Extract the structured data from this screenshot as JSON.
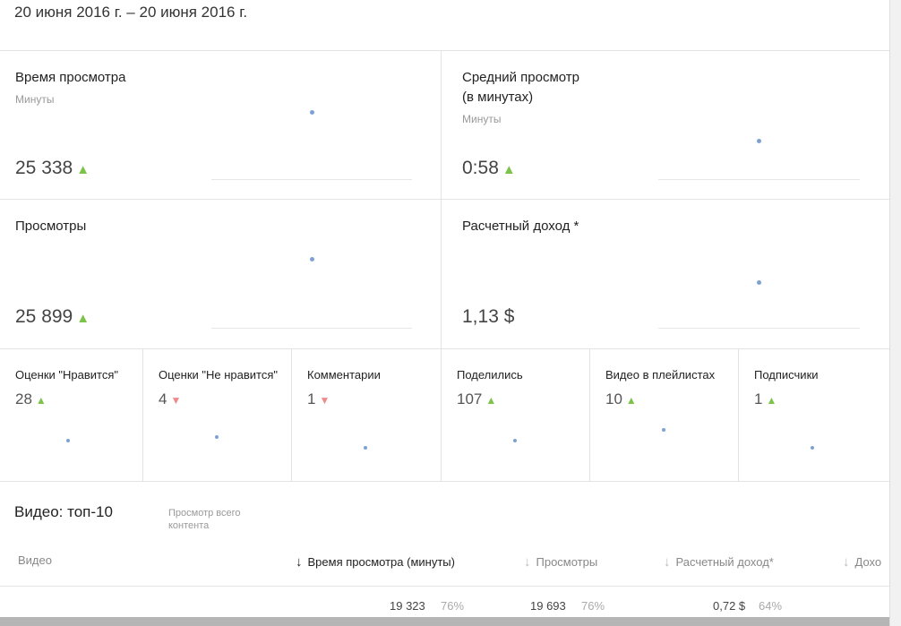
{
  "date_range": "20 июня 2016 г. – 20 июня 2016 г.",
  "big_cards": [
    {
      "title": "Время просмотра",
      "subtitle": "Минуты",
      "value": "25 338",
      "trend": "up"
    },
    {
      "title": "Средний просмотр",
      "title2": "(в минутах)",
      "subtitle": "Минуты",
      "value": "0:58",
      "trend": "up"
    },
    {
      "title": "Просмотры",
      "value": "25 899",
      "trend": "up"
    },
    {
      "title": "Расчетный доход *",
      "value": "1,13 $"
    }
  ],
  "small_cards": [
    {
      "title": "Оценки \"Нравится\"",
      "value": "28",
      "trend": "up"
    },
    {
      "title": "Оценки \"Не нравится\"",
      "value": "4",
      "trend": "down"
    },
    {
      "title": "Комментарии",
      "value": "1",
      "trend": "down"
    },
    {
      "title": "Поделились",
      "value": "107",
      "trend": "up"
    },
    {
      "title": "Видео в плейлистах",
      "value": "10",
      "trend": "up"
    },
    {
      "title": "Подписчики",
      "value": "1",
      "trend": "up"
    }
  ],
  "icons": {
    "up": "▲",
    "down": "▼",
    "sort": "↓"
  },
  "table": {
    "title": "Видео: топ-10",
    "link": "Просмотр всего",
    "link2": "контента",
    "headers": [
      "Видео",
      "Время просмотра (минуты)",
      "Просмотры",
      "Расчетный доход*",
      "Дохо"
    ],
    "total_row": {
      "watch_time": "19 323",
      "watch_pct": "76%",
      "views": "19 693",
      "views_pct": "76%",
      "revenue": "0,72 $",
      "revenue_pct": "64%"
    }
  }
}
